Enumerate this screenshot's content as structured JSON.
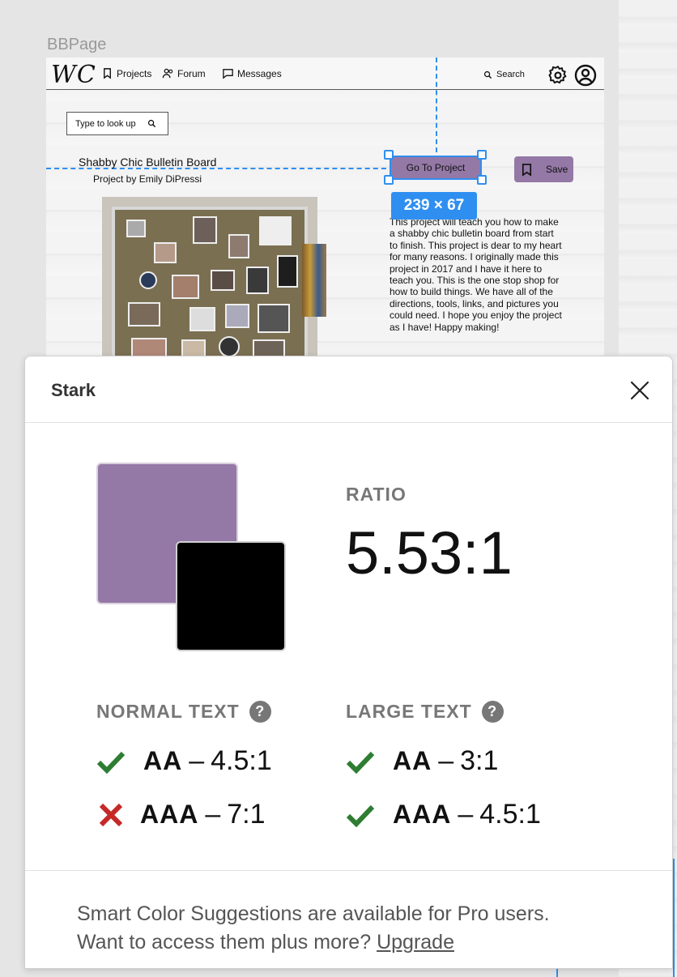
{
  "canvas": {
    "frame_label": "BBPage"
  },
  "nav": {
    "logo": "WC",
    "projects": "Projects",
    "forum": "Forum",
    "messages": "Messages",
    "search": "Search"
  },
  "page": {
    "lookup_placeholder": "Type to look up",
    "project_title": "Shabby Chic Bulletin Board",
    "project_author": "Project by Emily DiPressi",
    "goto_button": "Go To Project",
    "save_button": "Save",
    "selection_dimensions": "239 × 67",
    "description": "This project will teach you how to make a shabby chic bulletin board from start to finish. This project is dear to my heart for many reasons. I originally made this project in 2017 and I have it here to teach you. This is the one stop shop for how to build things. We have all of the directions, tools, links, and pictures you could need. I hope you enjoy the project as I have! Happy making!"
  },
  "stark": {
    "title": "Stark",
    "background_color": "#9478a6",
    "foreground_color": "#000000",
    "ratio_label": "RATIO",
    "ratio_value": "5.53:1",
    "normal_text": {
      "label": "NORMAL TEXT",
      "aa_label": "AA",
      "aa_threshold": "4.5:1",
      "aa_pass": true,
      "aaa_label": "AAA",
      "aaa_threshold": "7:1",
      "aaa_pass": false
    },
    "large_text": {
      "label": "LARGE TEXT",
      "aa_label": "AA",
      "aa_threshold": "3:1",
      "aa_pass": true,
      "aaa_label": "AAA",
      "aaa_threshold": "4.5:1",
      "aaa_pass": true
    },
    "footer_line1": "Smart Color Suggestions are available for Pro users.",
    "footer_line2": "Want to access them plus more?",
    "upgrade_link": "Upgrade",
    "pass_color": "#2e7d32",
    "fail_color": "#c62828"
  }
}
